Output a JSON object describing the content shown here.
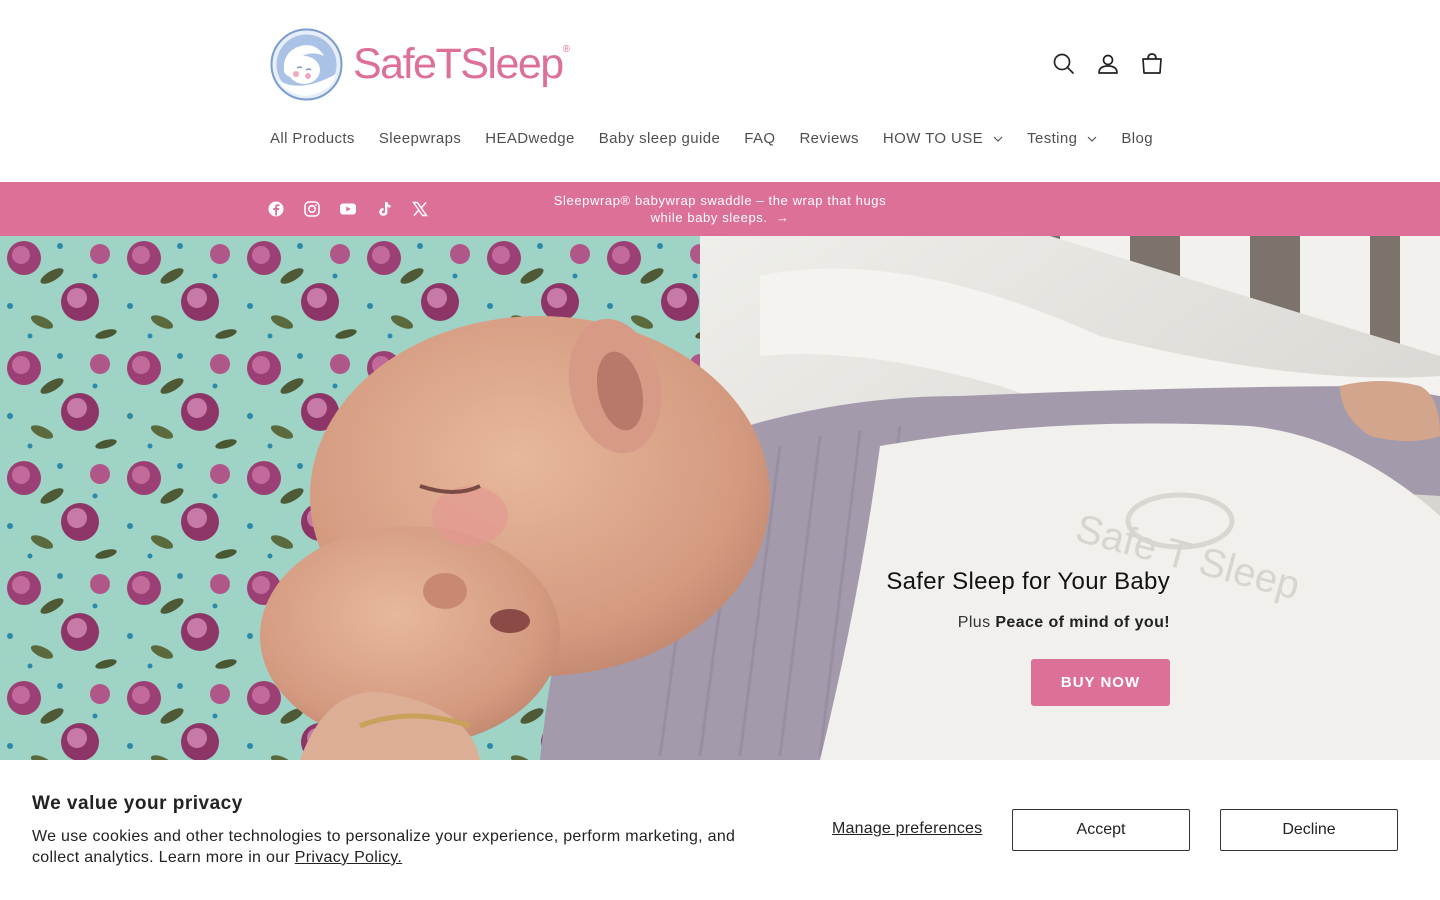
{
  "brand": {
    "name": "SafeTSleep",
    "registered": "®",
    "color": "#dd7099"
  },
  "header_icons": [
    "search-icon",
    "account-icon",
    "cart-icon"
  ],
  "nav": {
    "items": [
      {
        "label": "All Products"
      },
      {
        "label": "Sleepwraps"
      },
      {
        "label": "HEADwedge"
      },
      {
        "label": "Baby sleep guide"
      },
      {
        "label": "FAQ"
      },
      {
        "label": "Reviews"
      },
      {
        "label": "HOW TO USE",
        "dropdown": true
      },
      {
        "label": "Testing",
        "dropdown": true
      },
      {
        "label": "Blog"
      }
    ]
  },
  "announcement": {
    "line1": "Sleepwrap® babywrap swaddle – the wrap that hugs",
    "line2": "while baby sleeps.",
    "arrow": "→",
    "social": [
      "facebook-icon",
      "instagram-icon",
      "youtube-icon",
      "tiktok-icon",
      "x-icon"
    ],
    "bg": "#dd7099"
  },
  "hero": {
    "title": "Safer Sleep for Your Baby",
    "subtitle_prefix": "Plus ",
    "subtitle_bold": "Peace of mind of you!",
    "button": "BUY NOW",
    "watermark": "Safe T Sleep"
  },
  "cookie": {
    "title": "We value your privacy",
    "body": "We use cookies and other technologies to personalize your experience, perform marketing, and collect analytics. Learn more in our ",
    "link": "Privacy Policy.",
    "manage": "Manage preferences",
    "accept": "Accept",
    "decline": "Decline"
  }
}
